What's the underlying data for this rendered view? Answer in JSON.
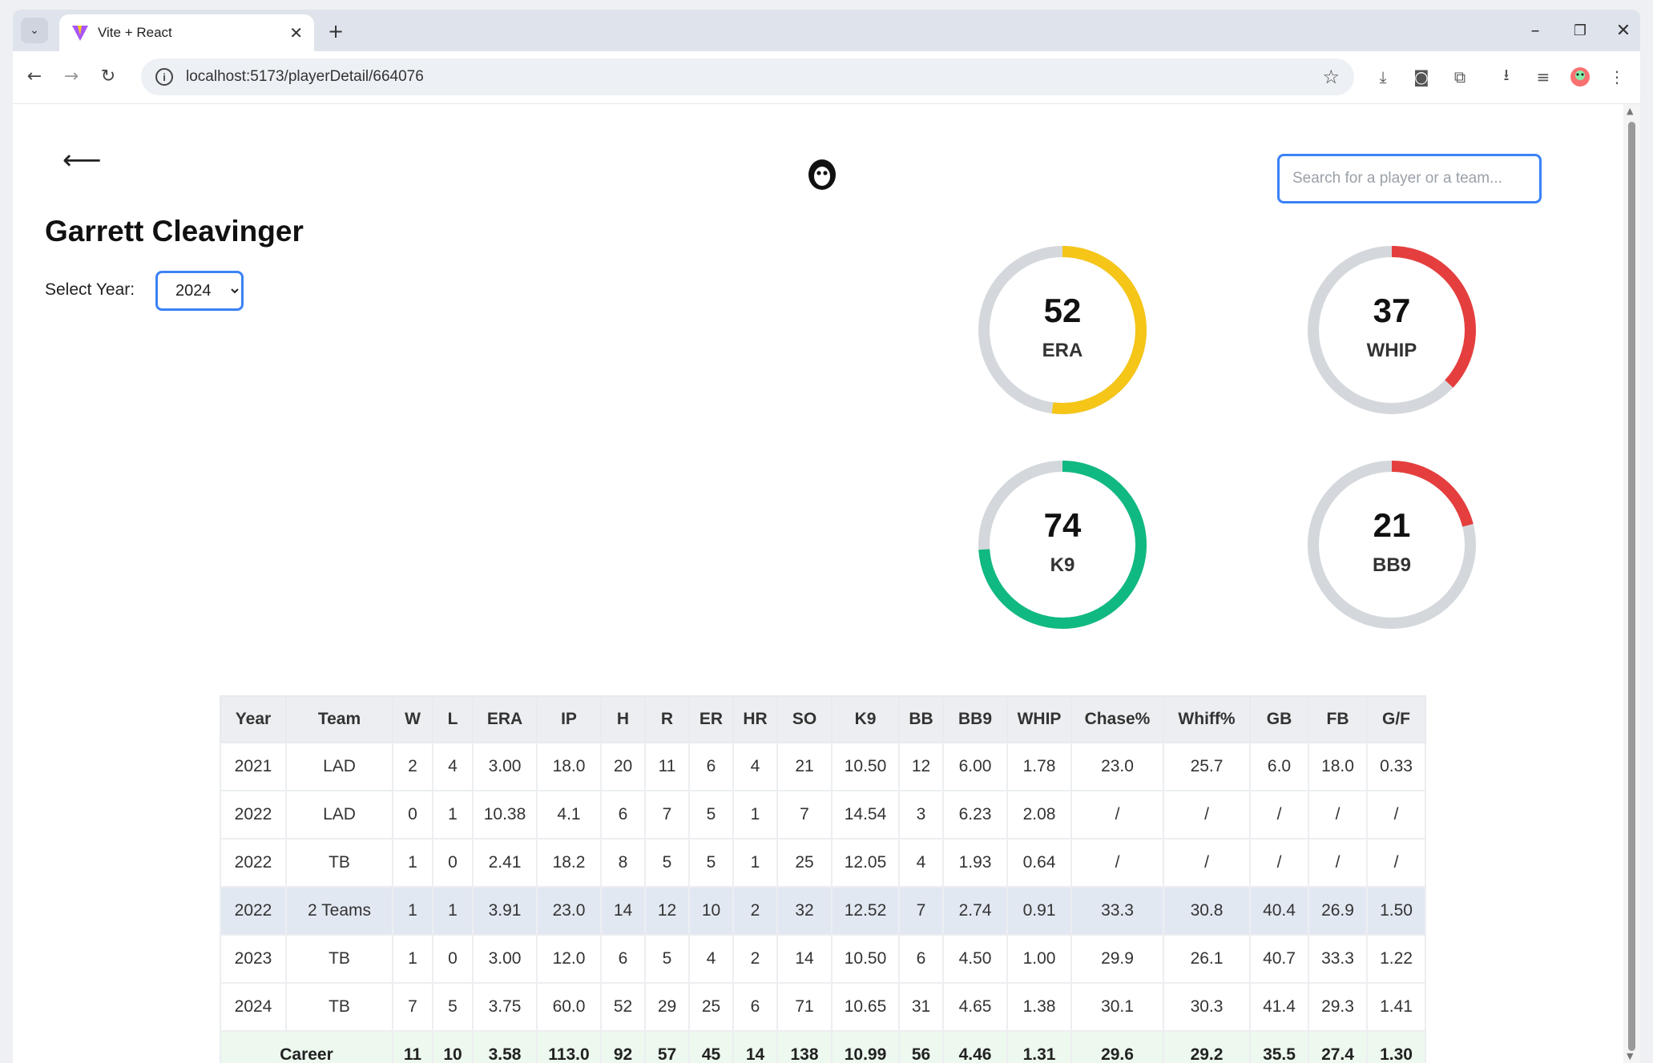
{
  "browser": {
    "tab_title": "Vite + React",
    "url": "localhost:5173/playerDetail/664076"
  },
  "page": {
    "search_placeholder": "Search for a player or a team...",
    "player_name": "Garrett Cleavinger",
    "select_year_label": "Select Year:",
    "selected_year": "2024"
  },
  "gauges": [
    {
      "label": "ERA",
      "value": "52",
      "percent": 52,
      "color": "#f5c518"
    },
    {
      "label": "WHIP",
      "value": "37",
      "percent": 37,
      "color": "#e53e3e"
    },
    {
      "label": "K9",
      "value": "74",
      "percent": 74,
      "color": "#10b981"
    },
    {
      "label": "BB9",
      "value": "21",
      "percent": 21,
      "color": "#e53e3e"
    }
  ],
  "table": {
    "headers": [
      "Year",
      "Team",
      "W",
      "L",
      "ERA",
      "IP",
      "H",
      "R",
      "ER",
      "HR",
      "SO",
      "K9",
      "BB",
      "BB9",
      "WHIP",
      "Chase%",
      "Whiff%",
      "GB",
      "FB",
      "G/F"
    ],
    "rows": [
      [
        "2021",
        "LAD",
        "2",
        "4",
        "3.00",
        "18.0",
        "20",
        "11",
        "6",
        "4",
        "21",
        "10.50",
        "12",
        "6.00",
        "1.78",
        "23.0",
        "25.7",
        "6.0",
        "18.0",
        "0.33"
      ],
      [
        "2022",
        "LAD",
        "0",
        "1",
        "10.38",
        "4.1",
        "6",
        "7",
        "5",
        "1",
        "7",
        "14.54",
        "3",
        "6.23",
        "2.08",
        "/",
        "/",
        "/",
        "/",
        "/"
      ],
      [
        "2022",
        "TB",
        "1",
        "0",
        "2.41",
        "18.2",
        "8",
        "5",
        "5",
        "1",
        "25",
        "12.05",
        "4",
        "1.93",
        "0.64",
        "/",
        "/",
        "/",
        "/",
        "/"
      ],
      [
        "2022",
        "2 Teams",
        "1",
        "1",
        "3.91",
        "23.0",
        "14",
        "12",
        "10",
        "2",
        "32",
        "12.52",
        "7",
        "2.74",
        "0.91",
        "33.3",
        "30.8",
        "40.4",
        "26.9",
        "1.50"
      ],
      [
        "2023",
        "TB",
        "1",
        "0",
        "3.00",
        "12.0",
        "6",
        "5",
        "4",
        "2",
        "14",
        "10.50",
        "6",
        "4.50",
        "1.00",
        "29.9",
        "26.1",
        "40.7",
        "33.3",
        "1.22"
      ],
      [
        "2024",
        "TB",
        "7",
        "5",
        "3.75",
        "60.0",
        "52",
        "29",
        "25",
        "6",
        "71",
        "10.65",
        "31",
        "4.65",
        "1.38",
        "30.1",
        "30.3",
        "41.4",
        "29.3",
        "1.41"
      ]
    ],
    "career": [
      "Career",
      "11",
      "10",
      "3.58",
      "113.0",
      "92",
      "57",
      "45",
      "14",
      "138",
      "10.99",
      "56",
      "4.46",
      "1.31",
      "29.6",
      "29.2",
      "35.5",
      "27.4",
      "1.30"
    ]
  }
}
